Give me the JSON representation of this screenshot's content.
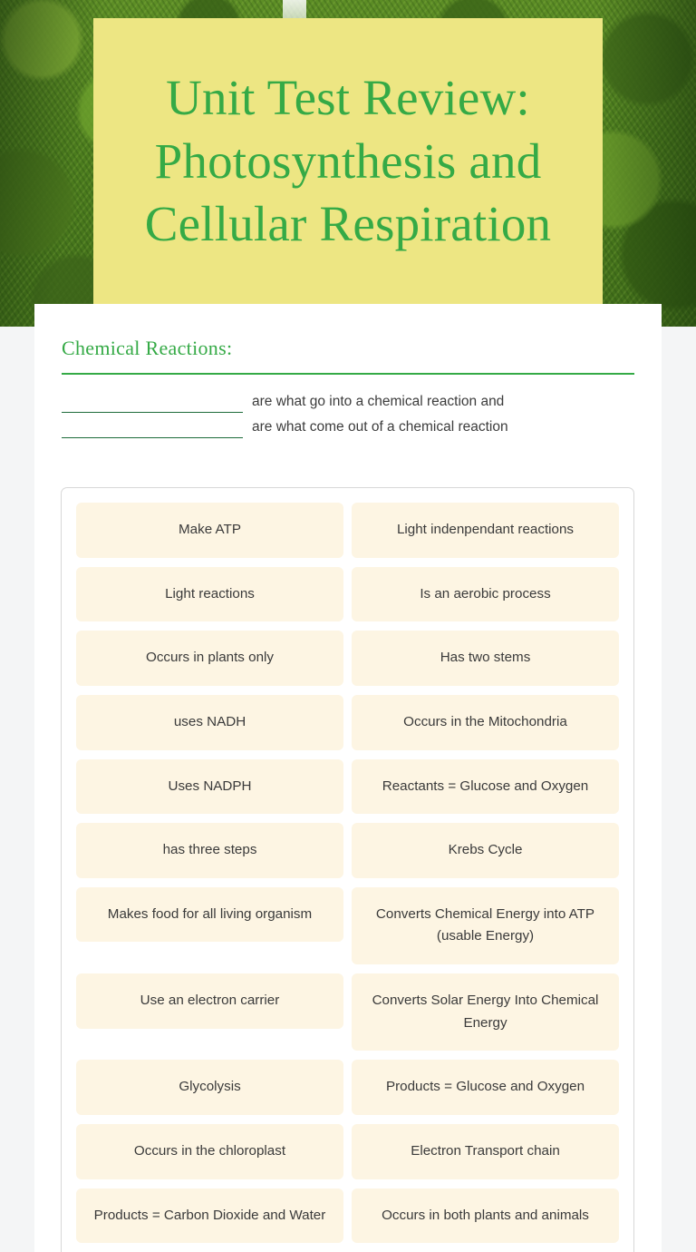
{
  "hero": {
    "title": "Unit Test Review: Photosynthesis and Cellular Respiration",
    "band_color": "#ede683",
    "title_color": "#35aa46"
  },
  "section": {
    "heading": "Chemical Reactions:",
    "accent_color": "#35aa46"
  },
  "blanks": [
    {
      "value": "",
      "placeholder": "",
      "text": "are what go into a chemical reaction and"
    },
    {
      "value": "",
      "placeholder": "",
      "text": "are what come out of a chemical reaction"
    }
  ],
  "word_bank": {
    "tile_color": "#fdf5e3",
    "tiles": [
      {
        "label": "Make ATP",
        "column": "left",
        "lines": 1
      },
      {
        "label": "Light indenpendant reactions",
        "column": "right",
        "lines": 1
      },
      {
        "label": "Light reactions",
        "column": "left",
        "lines": 1
      },
      {
        "label": "Is an aerobic process",
        "column": "right",
        "lines": 1
      },
      {
        "label": "Occurs in plants only",
        "column": "left",
        "lines": 1
      },
      {
        "label": "Has two stems",
        "column": "right",
        "lines": 1
      },
      {
        "label": "uses NADH",
        "column": "left",
        "lines": 1
      },
      {
        "label": "Occurs in the Mitochondria",
        "column": "right",
        "lines": 1
      },
      {
        "label": "Uses NADPH",
        "column": "left",
        "lines": 1
      },
      {
        "label": "Reactants = Glucose and Oxygen",
        "column": "right",
        "lines": 2
      },
      {
        "label": "has three steps",
        "column": "left",
        "lines": 1
      },
      {
        "label": "Krebs Cycle",
        "column": "right",
        "lines": 1
      },
      {
        "label": "Makes food for all living organism",
        "column": "left",
        "lines": 2
      },
      {
        "label": "Converts Chemical Energy into ATP (usable Energy)",
        "column": "right",
        "lines": 2
      },
      {
        "label": "Use an electron carrier",
        "column": "left",
        "lines": 1
      },
      {
        "label": "Converts Solar Energy Into Chemical Energy",
        "column": "right",
        "lines": 2
      },
      {
        "label": "Glycolysis",
        "column": "left",
        "lines": 1
      },
      {
        "label": "Products = Glucose and Oxygen",
        "column": "right",
        "lines": 2
      },
      {
        "label": "Occurs in the chloroplast",
        "column": "left",
        "lines": 1
      },
      {
        "label": "Electron Transport chain",
        "column": "right",
        "lines": 1
      },
      {
        "label": "Products = Carbon Dioxide and Water",
        "column": "left",
        "lines": 2
      },
      {
        "label": "Occurs in both plants and animals",
        "column": "right",
        "lines": 2
      }
    ]
  }
}
